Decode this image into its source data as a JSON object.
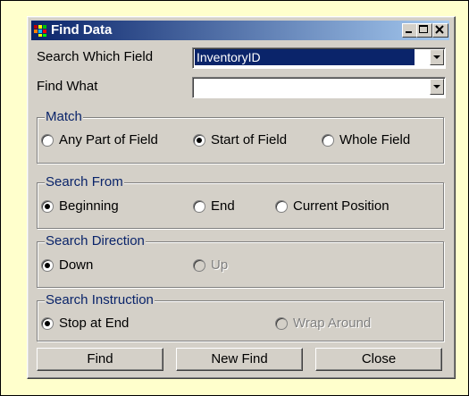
{
  "window": {
    "title": "Find Data",
    "icon": "app-grid-icon",
    "controls": [
      "minimize-icon",
      "maximize-icon",
      "close-icon"
    ]
  },
  "fields": {
    "search_label": "Search Which Field",
    "search_value": "InventoryID",
    "find_label": "Find What",
    "find_value": ""
  },
  "match": {
    "legend": "Match",
    "options": [
      "Any Part of Field",
      "Start of Field",
      "Whole Field"
    ],
    "selected": "Start of Field"
  },
  "search_from": {
    "legend": "Search From",
    "options": [
      "Beginning",
      "End",
      "Current Position"
    ],
    "selected": "Beginning"
  },
  "search_direction": {
    "legend": "Search Direction",
    "options": [
      "Down",
      "Up"
    ],
    "selected": "Down",
    "disabled": [
      "Up"
    ]
  },
  "search_instruction": {
    "legend": "Search Instruction",
    "options": [
      "Stop at End",
      "Wrap Around"
    ],
    "selected": "Stop at End",
    "disabled": [
      "Wrap Around"
    ]
  },
  "buttons": {
    "find": "Find",
    "new_find": "New Find",
    "close": "Close"
  },
  "colors": {
    "page_background": "#ffffcc",
    "dialog_face": "#d4d0c8",
    "titlebar_start": "#0a246a",
    "titlebar_end": "#a6caf0",
    "group_legend": "#0a246a",
    "selection": "#0a246a"
  }
}
